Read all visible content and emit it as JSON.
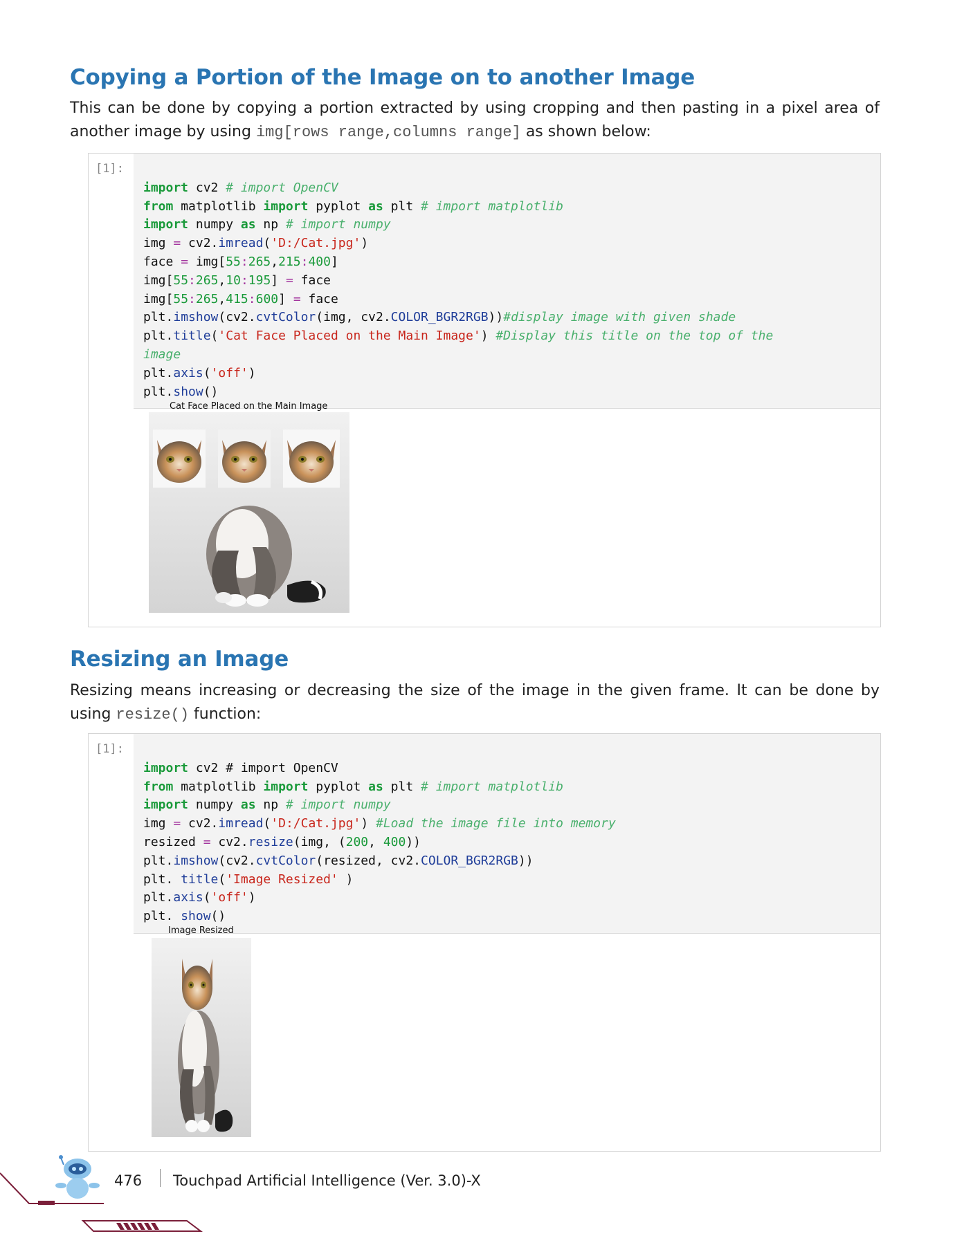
{
  "section1": {
    "heading": "Copying a Portion of the Image on to another Image",
    "para_before": "This can be done by copying a portion extracted by using cropping and then pasting in a pixel area of another image by using ",
    "para_code": "img[rows range,columns range]",
    "para_after": " as shown below:",
    "prompt": "[1]:",
    "code": {
      "l1_kw": "import",
      "l1_rest": " cv2 ",
      "l1_cm": "# import OpenCV",
      "l2_kw1": "from",
      "l2_mid": " matplotlib ",
      "l2_kw2": "import",
      "l2_mid2": " pyplot ",
      "l2_kw3": "as",
      "l2_rest": " plt ",
      "l2_cm": "# import matplotlib",
      "l3_kw": "import",
      "l3_mid": " numpy ",
      "l3_kw2": "as",
      "l3_rest": " np ",
      "l3_cm": "# import numpy",
      "l4_a": "img ",
      "l4_op": "=",
      "l4_b": " cv2.",
      "l4_fn": "imread",
      "l4_c": "(",
      "l4_str": "'D:/Cat.jpg'",
      "l4_d": ")",
      "l5_a": "face ",
      "l5_op": "=",
      "l5_b": " img[",
      "l5_n1": "55",
      "l5_c1": ":",
      "l5_n2": "265",
      "l5_c2": ",",
      "l5_n3": "215",
      "l5_c3": ":",
      "l5_n4": "400",
      "l5_d": "]",
      "l6_a": "img[",
      "l6_n1": "55",
      "l6_c1": ":",
      "l6_n2": "265",
      "l6_c2": ",",
      "l6_n3": "10",
      "l6_c3": ":",
      "l6_n4": "195",
      "l6_b": "] ",
      "l6_op": "=",
      "l6_rest": " face",
      "l7_a": "img[",
      "l7_n1": "55",
      "l7_c1": ":",
      "l7_n2": "265",
      "l7_c2": ",",
      "l7_n3": "415",
      "l7_c3": ":",
      "l7_n4": "600",
      "l7_b": "] ",
      "l7_op": "=",
      "l7_rest": " face",
      "l8_a": "plt.",
      "l8_fn1": "imshow",
      "l8_b": "(cv2.",
      "l8_fn2": "cvtColor",
      "l8_c": "(img, cv2.",
      "l8_fn3": "COLOR_BGR2RGB",
      "l8_d": "))",
      "l8_cm": "#display image with given shade",
      "l9_a": "plt.",
      "l9_fn": "title",
      "l9_b": "(",
      "l9_str": "'Cat Face Placed on the Main Image'",
      "l9_c": ") ",
      "l9_cm": "#Display this title on the top of the",
      "l10_cm": "image",
      "l11_a": "plt.",
      "l11_fn": "axis",
      "l11_b": "(",
      "l11_str": "'off'",
      "l11_c": ")",
      "l12_a": "plt.",
      "l12_fn": "show",
      "l12_b": "()"
    },
    "figure_title": "Cat Face Placed on the Main Image"
  },
  "section2": {
    "heading": "Resizing an Image",
    "para_before": "Resizing means increasing or decreasing the size of the image in the given frame. It can be done by using ",
    "para_code": "resize()",
    "para_after": " function:",
    "prompt": "[1]:",
    "code": {
      "l1_kw": "import",
      "l1_rest": " cv2 # import OpenCV",
      "l2_kw1": "from",
      "l2_mid": " matplotlib ",
      "l2_kw2": "import",
      "l2_mid2": " pyplot ",
      "l2_kw3": "as",
      "l2_rest": " plt ",
      "l2_cm": "# import matplotlib",
      "l3_kw": "import",
      "l3_mid": " numpy ",
      "l3_kw2": "as",
      "l3_rest": " np ",
      "l3_cm": "# import numpy",
      "l4_a": "img ",
      "l4_op": "=",
      "l4_b": " cv2.",
      "l4_fn": "imread",
      "l4_c": "(",
      "l4_str": "'D:/Cat.jpg'",
      "l4_d": ") ",
      "l4_cm": "#Load the image file into memory",
      "l5_a": "resized ",
      "l5_op": "=",
      "l5_b": " cv2.",
      "l5_fn": "resize",
      "l5_c": "(img, (",
      "l5_n1": "200",
      "l5_d": ", ",
      "l5_n2": "400",
      "l5_e": "))",
      "l6_a": "plt.",
      "l6_fn1": "imshow",
      "l6_b": "(cv2.",
      "l6_fn2": "cvtColor",
      "l6_c": "(resized, cv2.",
      "l6_fn3": "COLOR_BGR2RGB",
      "l6_d": "))",
      "l7_a": "plt. ",
      "l7_fn": "title",
      "l7_b": "(",
      "l7_str": "'Image Resized'",
      "l7_c": " )",
      "l8_a": "plt.",
      "l8_fn": "axis",
      "l8_b": "(",
      "l8_str": "'off'",
      "l8_c": ")",
      "l9_a": "plt. ",
      "l9_fn": "show",
      "l9_b": "()"
    },
    "figure_title": "Image Resized"
  },
  "footer": {
    "page_number": "476",
    "book_title": "Touchpad Artificial Intelligence (Ver. 3.0)-X"
  },
  "colors": {
    "heading": "#2a75b2",
    "keyword": "#1a9a3a",
    "comment": "#4ab06d",
    "string": "#c8261c",
    "function": "#1f3d99",
    "operator": "#a3359e",
    "footer_accent": "#7b1f3a"
  }
}
